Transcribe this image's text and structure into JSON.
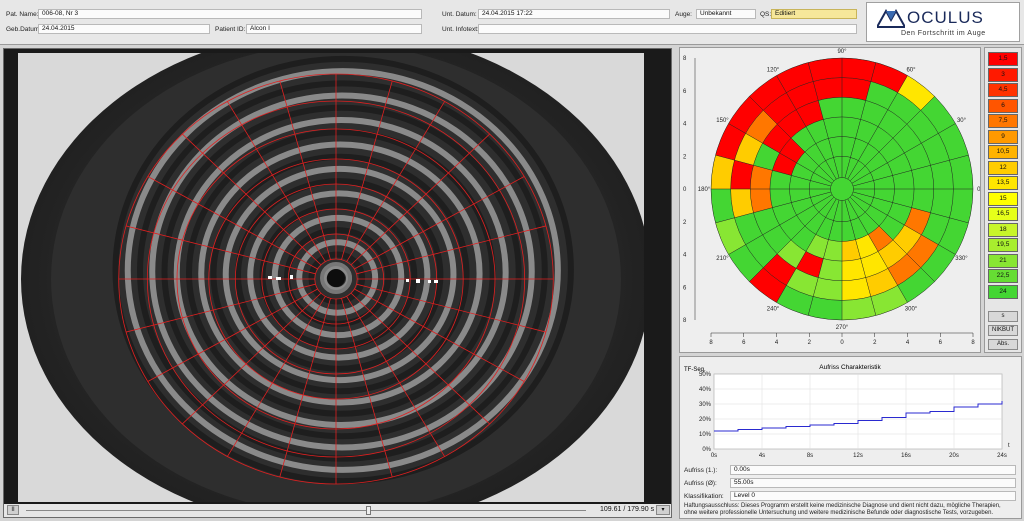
{
  "header": {
    "pat_name_label": "Pat. Name:",
    "pat_name_value": "006-08, Nr 3",
    "geb_datum_label": "Geb.Datum:",
    "geb_datum_value": "24.04.2015",
    "patient_id_label": "Patient ID:",
    "patient_id_value": "Alcon I",
    "unt_datum_label": "Unt. Datum:",
    "unt_datum_value": "24.04.2015 17:22",
    "auge_label": "Auge:",
    "auge_value": "Unbekannt",
    "qs_label": "QS:",
    "qs_value": "Editiert",
    "infotext_label": "Unt. Infotext:",
    "infotext_value": ""
  },
  "logo": {
    "brand": "OCULUS",
    "slogan": "Den Fortschritt im Auge",
    "icon": "oculus-logo-icon"
  },
  "player": {
    "play_label": "II",
    "time_text": "109.61 / 179.90 s",
    "position_fraction": 0.61,
    "menu_icon": "player-menu-icon"
  },
  "map": {
    "angle_labels": [
      "0°",
      "30°",
      "60°",
      "90°",
      "120°",
      "150°",
      "180°",
      "210°",
      "240°",
      "270°",
      "300°",
      "330°"
    ],
    "left_axis_ticks": [
      "8",
      "6",
      "4",
      "2",
      "0",
      "2",
      "4",
      "6",
      "8"
    ],
    "bottom_axis_ticks": [
      "8",
      "6",
      "4",
      "2",
      "0",
      "2",
      "4",
      "6",
      "8"
    ],
    "ring_radii_data": [
      0.7,
      2.0,
      3.2,
      4.4,
      5.6,
      6.8,
      8.0
    ],
    "rows": [
      [
        1,
        1,
        1,
        1,
        1,
        1,
        1,
        1,
        1,
        1,
        1,
        1,
        1,
        1,
        1,
        1,
        1,
        1,
        1,
        1,
        1,
        1,
        1,
        1
      ],
      [
        0,
        0,
        0,
        0,
        0,
        0,
        0,
        0,
        0,
        0,
        0,
        0,
        0,
        1,
        1,
        1,
        1,
        1,
        1,
        1,
        1,
        1,
        1,
        0
      ],
      [
        0,
        0,
        0,
        0,
        0,
        0,
        0,
        0,
        0,
        0,
        0,
        0,
        0,
        0,
        0,
        0,
        0,
        0,
        0,
        0,
        0,
        0,
        0,
        0
      ],
      [
        0,
        0,
        0,
        0,
        0,
        0,
        0,
        0,
        0,
        0,
        0,
        0,
        0,
        0,
        0,
        0,
        0,
        0,
        0,
        0,
        0,
        0,
        0,
        0
      ],
      [
        0,
        0,
        0,
        0,
        0,
        0,
        0,
        0,
        0,
        0,
        0,
        0,
        0,
        0,
        0,
        0,
        0,
        0,
        0,
        0,
        0,
        0,
        0,
        0
      ],
      [
        0,
        0,
        0,
        0,
        0,
        0,
        0,
        0,
        0,
        0,
        0,
        0,
        0,
        0,
        0,
        0,
        0,
        0,
        0,
        0,
        0,
        0,
        0,
        0
      ]
    ]
  },
  "scale": {
    "items": [
      {
        "label": "1,5",
        "color": "#ff0000"
      },
      {
        "label": "3",
        "color": "#ff1a00"
      },
      {
        "label": "4,5",
        "color": "#ff3300"
      },
      {
        "label": "6",
        "color": "#ff5500"
      },
      {
        "label": "7,5",
        "color": "#ff7700"
      },
      {
        "label": "9",
        "color": "#ff9900"
      },
      {
        "label": "10,5",
        "color": "#ffb300"
      },
      {
        "label": "12",
        "color": "#ffcc00"
      },
      {
        "label": "13,5",
        "color": "#ffe600"
      },
      {
        "label": "15",
        "color": "#ffff00"
      },
      {
        "label": "16,5",
        "color": "#e6ff1a"
      },
      {
        "label": "18",
        "color": "#c8f52a"
      },
      {
        "label": "19,5",
        "color": "#a8ee2e"
      },
      {
        "label": "21",
        "color": "#88e633"
      },
      {
        "label": "22,5",
        "color": "#66dd33"
      },
      {
        "label": "24",
        "color": "#44d633"
      }
    ],
    "s_label": "s",
    "nikbut_label": "NIKBUT",
    "abs_label": "Abs."
  },
  "chart": {
    "ylabel": "TF-Seg.",
    "title": "Aufriss Charakteristik",
    "y_ticks": [
      "50%",
      "40%",
      "30%",
      "20%",
      "10%",
      "0%"
    ],
    "x_ticks": [
      "0s",
      "4s",
      "8s",
      "12s",
      "16s",
      "20s",
      "24s"
    ],
    "x_unit": "t",
    "aufriss1_label": "Aufriss (1.):",
    "aufriss1_value": "0.00s",
    "aufrissavg_label": "Aufriss (Ø):",
    "aufrissavg_value": "55.00s",
    "klass_label": "Klassifikation:",
    "klass_value": "Level 0",
    "disclaimer": "Haftungsausschluss: Dieses Programm erstellt keine medizinische Diagnose und dient nicht dazu, mögliche Therapien, ohne weitere professionelle Untersuchung und weitere medizinische Befunde oder diagnostische Tests, vorzugeben."
  },
  "chart_data": {
    "type": "line",
    "title": "Aufriss Charakteristik",
    "xlabel": "t",
    "ylabel": "TF-Seg.",
    "xlim": [
      0,
      24
    ],
    "ylim": [
      0,
      50
    ],
    "x": [
      0,
      2,
      4,
      6,
      8,
      10,
      12,
      14,
      16,
      18,
      20,
      22,
      24
    ],
    "series": [
      {
        "values": [
          12,
          13,
          14,
          15,
          16,
          17,
          19,
          21,
          24,
          25,
          28,
          30,
          32
        ]
      }
    ]
  }
}
